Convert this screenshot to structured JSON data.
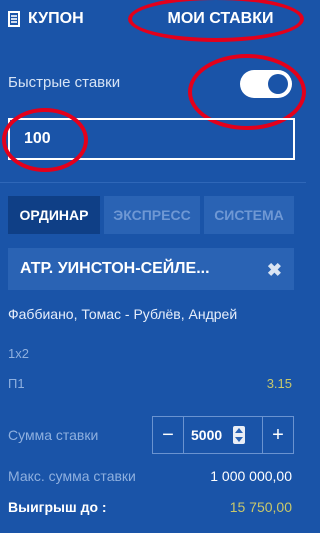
{
  "tabs": {
    "coupon": "КУПОН",
    "my_bets": "МОИ СТАВКИ"
  },
  "quick_bets": {
    "label": "Быстрые ставки",
    "enabled": true,
    "value": "100"
  },
  "bet_types": {
    "single": "ОРДИНАР",
    "express": "ЭКСПРЕСС",
    "system": "СИСТЕМА",
    "active": "single"
  },
  "event": {
    "title": "АТР. УИНСТОН-СЕЙЛЕ...",
    "players": "Фаббиано, Томас - Рублёв, Андрей",
    "market": "1x2",
    "outcome": "П1",
    "odds": "3.15"
  },
  "stake": {
    "label": "Сумма ставки",
    "value": "5000",
    "minus": "−",
    "plus": "+"
  },
  "max_stake": {
    "label": "Макс. сумма ставки",
    "value": "1 000 000,00"
  },
  "win": {
    "label": "Выигрыш до :",
    "value": "15 750,00"
  },
  "colors": {
    "background": "#1a54a8",
    "highlight": "#e3001b",
    "odds": "#c9c86a"
  }
}
